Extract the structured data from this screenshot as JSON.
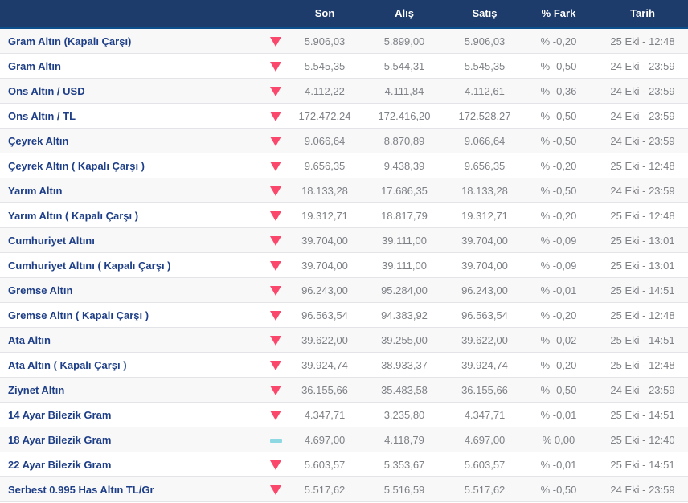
{
  "colors": {
    "header_bg": "#1e3c6b",
    "header_border": "#0d4e8c",
    "name_color": "#1e3f87",
    "value_color": "#7d8085",
    "down_arrow": "#f9486b",
    "flat_dash": "#8ed8e3",
    "row_odd_bg": "#f8f8f9",
    "row_even_bg": "#ffffff"
  },
  "table": {
    "columns": {
      "son": "Son",
      "alis": "Alış",
      "satis": "Satış",
      "fark": "% Fark",
      "tarih": "Tarih"
    },
    "rows": [
      {
        "name": "Gram Altın (Kapalı Çarşı)",
        "trend": "down",
        "son": "5.906,03",
        "alis": "5.899,00",
        "satis": "5.906,03",
        "fark": "% -0,20",
        "tarih": "25 Eki - 12:48"
      },
      {
        "name": "Gram Altın",
        "trend": "down",
        "son": "5.545,35",
        "alis": "5.544,31",
        "satis": "5.545,35",
        "fark": "% -0,50",
        "tarih": "24 Eki - 23:59"
      },
      {
        "name": "Ons Altın / USD",
        "trend": "down",
        "son": "4.112,22",
        "alis": "4.111,84",
        "satis": "4.112,61",
        "fark": "% -0,36",
        "tarih": "24 Eki - 23:59"
      },
      {
        "name": "Ons Altın / TL",
        "trend": "down",
        "son": "172.472,24",
        "alis": "172.416,20",
        "satis": "172.528,27",
        "fark": "% -0,50",
        "tarih": "24 Eki - 23:59"
      },
      {
        "name": "Çeyrek Altın",
        "trend": "down",
        "son": "9.066,64",
        "alis": "8.870,89",
        "satis": "9.066,64",
        "fark": "% -0,50",
        "tarih": "24 Eki - 23:59"
      },
      {
        "name": "Çeyrek Altın ( Kapalı Çarşı )",
        "trend": "down",
        "son": "9.656,35",
        "alis": "9.438,39",
        "satis": "9.656,35",
        "fark": "% -0,20",
        "tarih": "25 Eki - 12:48"
      },
      {
        "name": "Yarım Altın",
        "trend": "down",
        "son": "18.133,28",
        "alis": "17.686,35",
        "satis": "18.133,28",
        "fark": "% -0,50",
        "tarih": "24 Eki - 23:59"
      },
      {
        "name": "Yarım Altın ( Kapalı Çarşı )",
        "trend": "down",
        "son": "19.312,71",
        "alis": "18.817,79",
        "satis": "19.312,71",
        "fark": "% -0,20",
        "tarih": "25 Eki - 12:48"
      },
      {
        "name": "Cumhuriyet Altını",
        "trend": "down",
        "son": "39.704,00",
        "alis": "39.111,00",
        "satis": "39.704,00",
        "fark": "% -0,09",
        "tarih": "25 Eki - 13:01"
      },
      {
        "name": "Cumhuriyet Altını ( Kapalı Çarşı )",
        "trend": "down",
        "son": "39.704,00",
        "alis": "39.111,00",
        "satis": "39.704,00",
        "fark": "% -0,09",
        "tarih": "25 Eki - 13:01"
      },
      {
        "name": "Gremse Altın",
        "trend": "down",
        "son": "96.243,00",
        "alis": "95.284,00",
        "satis": "96.243,00",
        "fark": "% -0,01",
        "tarih": "25 Eki - 14:51"
      },
      {
        "name": "Gremse Altın ( Kapalı Çarşı )",
        "trend": "down",
        "son": "96.563,54",
        "alis": "94.383,92",
        "satis": "96.563,54",
        "fark": "% -0,20",
        "tarih": "25 Eki - 12:48"
      },
      {
        "name": "Ata Altın",
        "trend": "down",
        "son": "39.622,00",
        "alis": "39.255,00",
        "satis": "39.622,00",
        "fark": "% -0,02",
        "tarih": "25 Eki - 14:51"
      },
      {
        "name": "Ata Altın ( Kapalı Çarşı )",
        "trend": "down",
        "son": "39.924,74",
        "alis": "38.933,37",
        "satis": "39.924,74",
        "fark": "% -0,20",
        "tarih": "25 Eki - 12:48"
      },
      {
        "name": "Ziynet Altın",
        "trend": "down",
        "son": "36.155,66",
        "alis": "35.483,58",
        "satis": "36.155,66",
        "fark": "% -0,50",
        "tarih": "24 Eki - 23:59"
      },
      {
        "name": "14 Ayar Bilezik Gram",
        "trend": "down",
        "son": "4.347,71",
        "alis": "3.235,80",
        "satis": "4.347,71",
        "fark": "% -0,01",
        "tarih": "25 Eki - 14:51"
      },
      {
        "name": "18 Ayar Bilezik Gram",
        "trend": "flat",
        "son": "4.697,00",
        "alis": "4.118,79",
        "satis": "4.697,00",
        "fark": "% 0,00",
        "tarih": "25 Eki - 12:40"
      },
      {
        "name": "22 Ayar Bilezik Gram",
        "trend": "down",
        "son": "5.603,57",
        "alis": "5.353,67",
        "satis": "5.603,57",
        "fark": "% -0,01",
        "tarih": "25 Eki - 14:51"
      },
      {
        "name": "Serbest 0.995 Has Altın TL/Gr",
        "trend": "down",
        "son": "5.517,62",
        "alis": "5.516,59",
        "satis": "5.517,62",
        "fark": "% -0,50",
        "tarih": "24 Eki - 23:59"
      }
    ]
  }
}
